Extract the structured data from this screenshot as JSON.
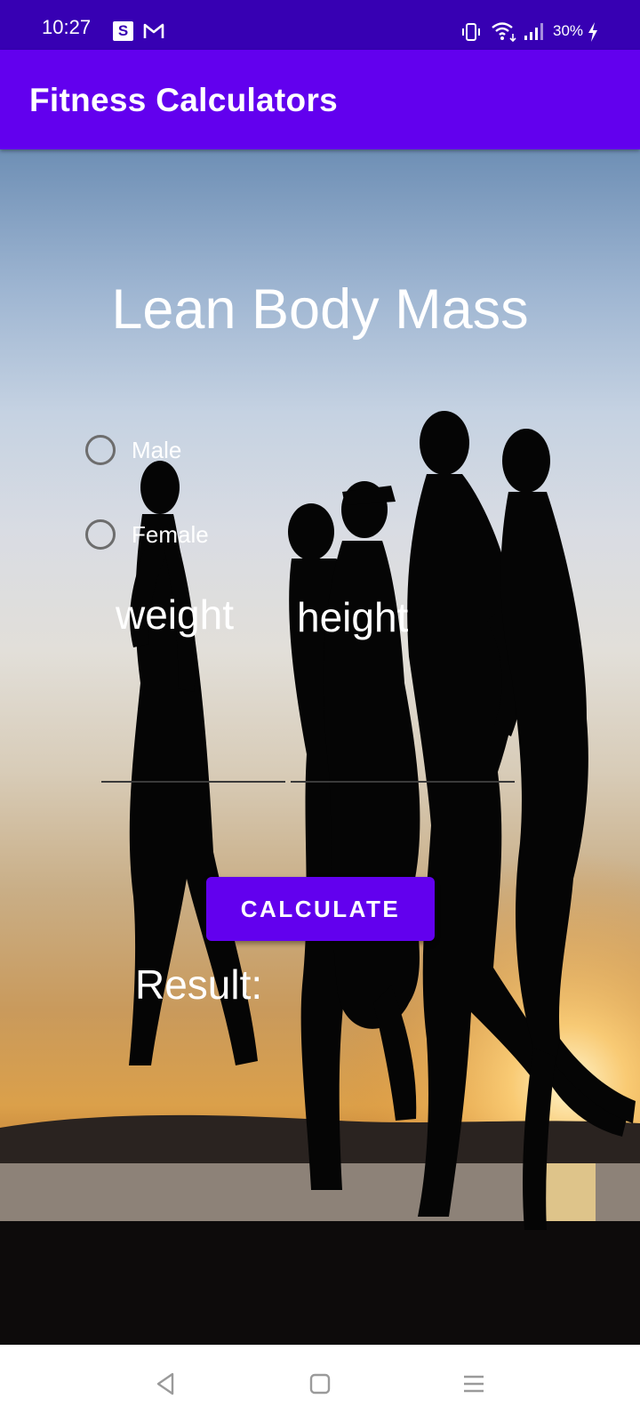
{
  "status_bar": {
    "time": "10:27",
    "s_badge": "S",
    "battery": "30%",
    "icons": [
      "s-app-icon",
      "gmail-icon",
      "vibrate-icon",
      "wifi-icon",
      "signal-icon",
      "charging-icon"
    ]
  },
  "app_bar": {
    "title": "Fitness Calculators"
  },
  "main": {
    "title": "Lean Body Mass",
    "gender_options": [
      "Male",
      "Female"
    ],
    "weight_label": "weight",
    "height_label": "height",
    "weight_value": "",
    "height_value": "",
    "calculate_label": "CALCULATE",
    "result_label": "Result:"
  },
  "nav_bar": {
    "buttons": [
      "back-icon",
      "home-icon",
      "menu-icon"
    ]
  },
  "colors": {
    "status_bar": "#3700b3",
    "app_bar": "#6200ee",
    "button": "#6200ee"
  }
}
